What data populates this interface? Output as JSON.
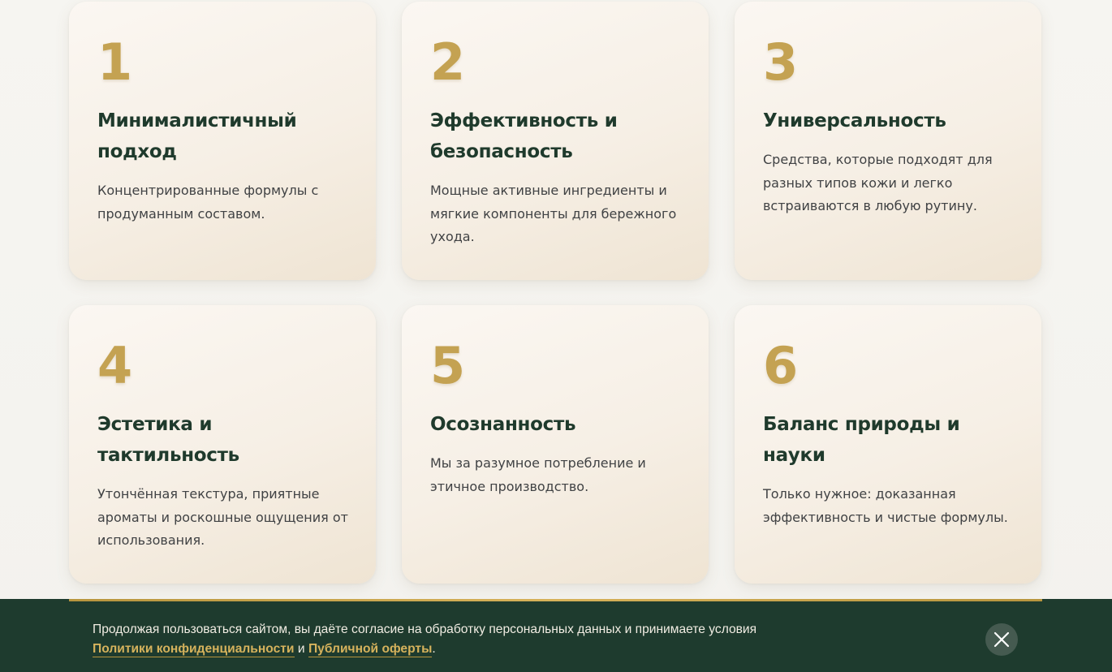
{
  "principles": [
    {
      "number": "1",
      "title": "Минималистичный подход",
      "description": "Концентрированные формулы с продуманным составом."
    },
    {
      "number": "2",
      "title": "Эффективность и безопасность",
      "description": "Мощные активные ингредиенты и мягкие компоненты для бережного ухода."
    },
    {
      "number": "3",
      "title": "Универсальность",
      "description": "Средства, которые подходят для разных типов кожи и легко встраиваются в любую рутину."
    },
    {
      "number": "4",
      "title": "Эстетика и тактильность",
      "description": "Утончённая текстура, приятные ароматы и роскошные ощущения от использования."
    },
    {
      "number": "5",
      "title": "Осознанность",
      "description": "Мы за разумное потребление и этичное производство."
    },
    {
      "number": "6",
      "title": "Баланс природы и науки",
      "description": "Только нужное: доказанная эффективность и чистые формулы."
    }
  ],
  "cookie_banner": {
    "text_line1": "Продолжая пользоваться сайтом, вы даёте согласие на обработку персональных данных и принимаете условия",
    "privacy_link": "Политики конфиденциальности",
    "conjunction": "и",
    "offer_link": "Публичной оферты",
    "period": ".",
    "close_icon": "close-icon"
  },
  "colors": {
    "accent_gold": "#c4a252",
    "title_green": "#1f3a2c",
    "banner_bg": "#1e3b2e",
    "card_bg": "#f6efe5"
  }
}
